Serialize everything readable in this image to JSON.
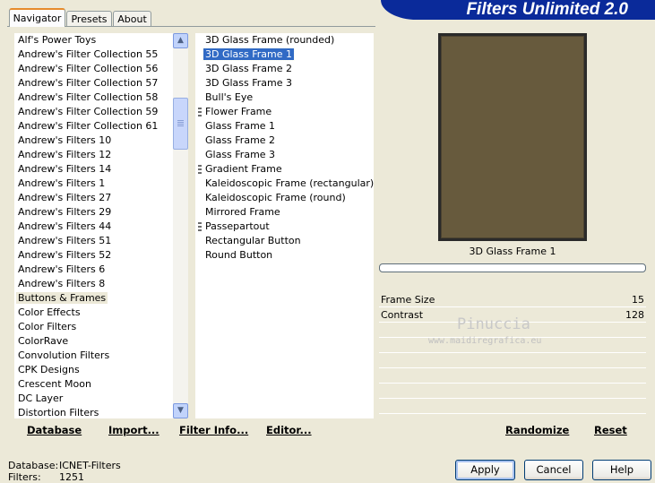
{
  "brand": "Filters Unlimited 2.0",
  "tabs": [
    "Navigator",
    "Presets",
    "About"
  ],
  "categories": [
    "Alf's Power Toys",
    "Andrew's Filter Collection 55",
    "Andrew's Filter Collection 56",
    "Andrew's Filter Collection 57",
    "Andrew's Filter Collection 58",
    "Andrew's Filter Collection 59",
    "Andrew's Filter Collection 61",
    "Andrew's Filters 10",
    "Andrew's Filters 12",
    "Andrew's Filters 14",
    "Andrew's Filters 1",
    "Andrew's Filters 27",
    "Andrew's Filters 29",
    "Andrew's Filters 44",
    "Andrew's Filters 51",
    "Andrew's Filters 52",
    "Andrew's Filters 6",
    "Andrew's Filters 8",
    "Buttons & Frames",
    "Color Effects",
    "Color Filters",
    "ColorRave",
    "Convolution Filters",
    "CPK Designs",
    "Crescent Moon",
    "DC Layer",
    "Distortion Filters"
  ],
  "selected_category": "Buttons & Frames",
  "filters": [
    {
      "label": "3D Glass Frame (rounded)",
      "group": false
    },
    {
      "label": "3D Glass Frame 1",
      "group": false
    },
    {
      "label": "3D Glass Frame 2",
      "group": false
    },
    {
      "label": "3D Glass Frame 3",
      "group": false
    },
    {
      "label": "Bull's Eye",
      "group": false
    },
    {
      "label": "Flower Frame",
      "group": true
    },
    {
      "label": "Glass Frame 1",
      "group": false
    },
    {
      "label": "Glass Frame 2",
      "group": false
    },
    {
      "label": "Glass Frame 3",
      "group": false
    },
    {
      "label": "Gradient Frame",
      "group": true
    },
    {
      "label": "Kaleidoscopic Frame (rectangular)",
      "group": false
    },
    {
      "label": "Kaleidoscopic Frame (round)",
      "group": false
    },
    {
      "label": "Mirrored Frame",
      "group": false
    },
    {
      "label": "Passepartout",
      "group": true
    },
    {
      "label": "Rectangular Button",
      "group": false
    },
    {
      "label": "Round Button",
      "group": false
    }
  ],
  "selected_filter": "3D Glass Frame 1",
  "preview": {
    "title": "3D Glass Frame 1",
    "color": "#675a3d",
    "progress": 0
  },
  "params": [
    {
      "label": "Frame Size",
      "value": "15"
    },
    {
      "label": "Contrast",
      "value": "128"
    }
  ],
  "watermark": {
    "name": "Pinuccia",
    "url": "www.maidiregrafica.eu"
  },
  "actions": {
    "database": "Database",
    "import": "Import...",
    "filter_info": "Filter Info...",
    "editor": "Editor...",
    "randomize": "Randomize",
    "reset": "Reset"
  },
  "status": {
    "database_label": "Database:",
    "database_value": "ICNET-Filters",
    "filters_label": "Filters:",
    "filters_value": "1251"
  },
  "buttons": {
    "apply": "Apply",
    "cancel": "Cancel",
    "help": "Help"
  }
}
